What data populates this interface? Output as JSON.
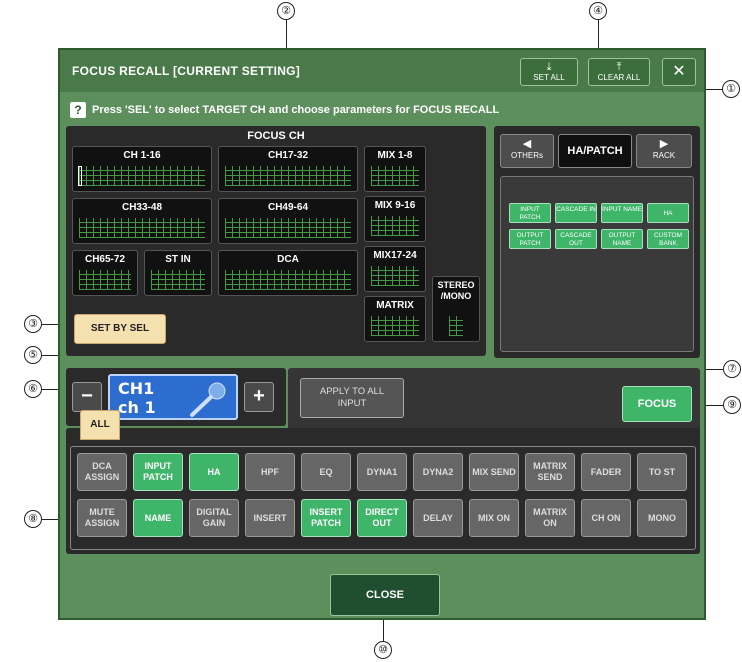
{
  "window": {
    "title": "FOCUS RECALL [CURRENT SETTING]",
    "set_all_label": "SET ALL",
    "clear_all_label": "CLEAR ALL",
    "close_glyph": "✕",
    "help_glyph": "?",
    "help_text": "Press 'SEL' to select TARGET CH and choose parameters for FOCUS RECALL"
  },
  "focus_ch": {
    "label": "FOCUS CH",
    "blocks": [
      "CH 1-16",
      "CH17-32",
      "CH33-48",
      "CH49-64",
      "CH65-72",
      "ST IN",
      "DCA",
      "MIX 1-8",
      "MIX 9-16",
      "MIX17-24",
      "MATRIX",
      "STEREO /MONO"
    ],
    "set_by_sel": "SET BY SEL"
  },
  "param_nav": {
    "prev_label": "OTHERs",
    "current": "HA/PATCH",
    "next_label": "RACK",
    "prev_arrow": "◀",
    "next_arrow": "▶",
    "items": [
      "INPUT PATCH",
      "CASCADE IN",
      "INPUT NAME",
      "HA",
      "OUTPUT PATCH",
      "CASCADE OUT",
      "OUTPUT NAME",
      "CUSTOM BANK"
    ]
  },
  "channel": {
    "line1": "CH1",
    "line2": "ch 1",
    "minus": "−",
    "plus": "+",
    "icon": "microphone-icon"
  },
  "apply_all": "APPLY TO ALL INPUT",
  "focus_button": "FOCUS",
  "all_tab": "ALL",
  "params": [
    {
      "label": "DCA ASSIGN",
      "on": false
    },
    {
      "label": "INPUT PATCH",
      "on": true
    },
    {
      "label": "HA",
      "on": true
    },
    {
      "label": "HPF",
      "on": false
    },
    {
      "label": "EQ",
      "on": false
    },
    {
      "label": "DYNA1",
      "on": false
    },
    {
      "label": "DYNA2",
      "on": false
    },
    {
      "label": "MIX SEND",
      "on": false
    },
    {
      "label": "MATRIX SEND",
      "on": false
    },
    {
      "label": "FADER",
      "on": false
    },
    {
      "label": "TO ST",
      "on": false
    },
    {
      "label": "MUTE ASSIGN",
      "on": false
    },
    {
      "label": "NAME",
      "on": true
    },
    {
      "label": "DIGITAL GAIN",
      "on": false
    },
    {
      "label": "INSERT",
      "on": false
    },
    {
      "label": "INSERT PATCH",
      "on": true
    },
    {
      "label": "DIRECT OUT",
      "on": true
    },
    {
      "label": "DELAY",
      "on": false
    },
    {
      "label": "MIX ON",
      "on": false
    },
    {
      "label": "MATRIX ON",
      "on": false
    },
    {
      "label": "CH ON",
      "on": false
    },
    {
      "label": "MONO",
      "on": false
    }
  ],
  "close_label": "CLOSE",
  "callouts": [
    "①",
    "②",
    "③",
    "④",
    "⑤",
    "⑥",
    "⑦",
    "⑧",
    "⑨",
    "⑩"
  ]
}
